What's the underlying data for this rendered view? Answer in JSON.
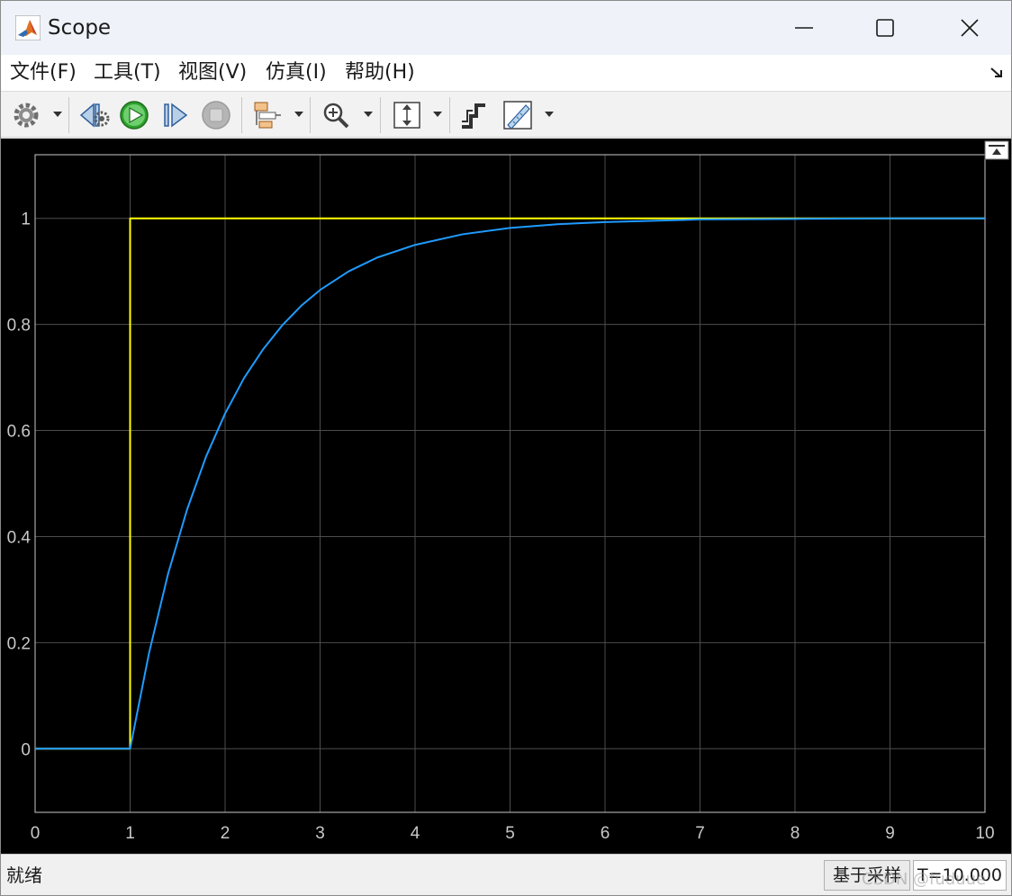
{
  "window": {
    "title": "Scope",
    "controls": [
      "minimize-icon",
      "maximize-icon",
      "close-icon"
    ]
  },
  "menu": {
    "items": [
      "文件(F)",
      "工具(T)",
      "视图(V)",
      "仿真(I)",
      "帮助(H)"
    ]
  },
  "toolbar": {
    "buttons": [
      "settings-gear-icon",
      "step-back-icon",
      "run-icon",
      "step-forward-icon",
      "stop-icon",
      "signal-select-icon",
      "zoom-in-icon",
      "scale-y-axis-icon",
      "triggers-icon",
      "measurements-icon"
    ],
    "run_color": "#2ea12e"
  },
  "chart_data": {
    "type": "line",
    "title": "",
    "xlabel": "",
    "ylabel": "",
    "xlim": [
      0,
      10
    ],
    "ylim": [
      -0.12,
      1.12
    ],
    "xticks": [
      "0",
      "1",
      "2",
      "3",
      "4",
      "5",
      "6",
      "7",
      "8",
      "9",
      "10"
    ],
    "yticks": [
      "0",
      "0.2",
      "0.4",
      "0.6",
      "0.8",
      "1"
    ],
    "grid": true,
    "background": "#000000",
    "grid_color": "#4d4d4d",
    "tick_color": "#c8c8c8",
    "series": [
      {
        "color": "#ffff00",
        "x": [
          0,
          1,
          1,
          10
        ],
        "y": [
          0,
          0,
          1,
          1
        ]
      },
      {
        "color": "#1f9bff",
        "x": [
          0,
          1,
          1.2,
          1.4,
          1.6,
          1.8,
          2.0,
          2.2,
          2.4,
          2.6,
          2.8,
          3.0,
          3.3,
          3.6,
          4.0,
          4.5,
          5.0,
          5.5,
          6.0,
          7.0,
          8.0,
          9.0,
          10.0
        ],
        "y": [
          0,
          0,
          0.181,
          0.33,
          0.451,
          0.551,
          0.632,
          0.699,
          0.753,
          0.798,
          0.835,
          0.865,
          0.9,
          0.926,
          0.95,
          0.97,
          0.982,
          0.989,
          0.993,
          0.998,
          0.999,
          1.0,
          1.0
        ]
      }
    ]
  },
  "plot_controls": {
    "undock_icon": "undock-icon"
  },
  "status": {
    "state": "就绪",
    "mode": "基于采样",
    "time": "T=10.000"
  },
  "watermark": "CSDN @fuduue"
}
